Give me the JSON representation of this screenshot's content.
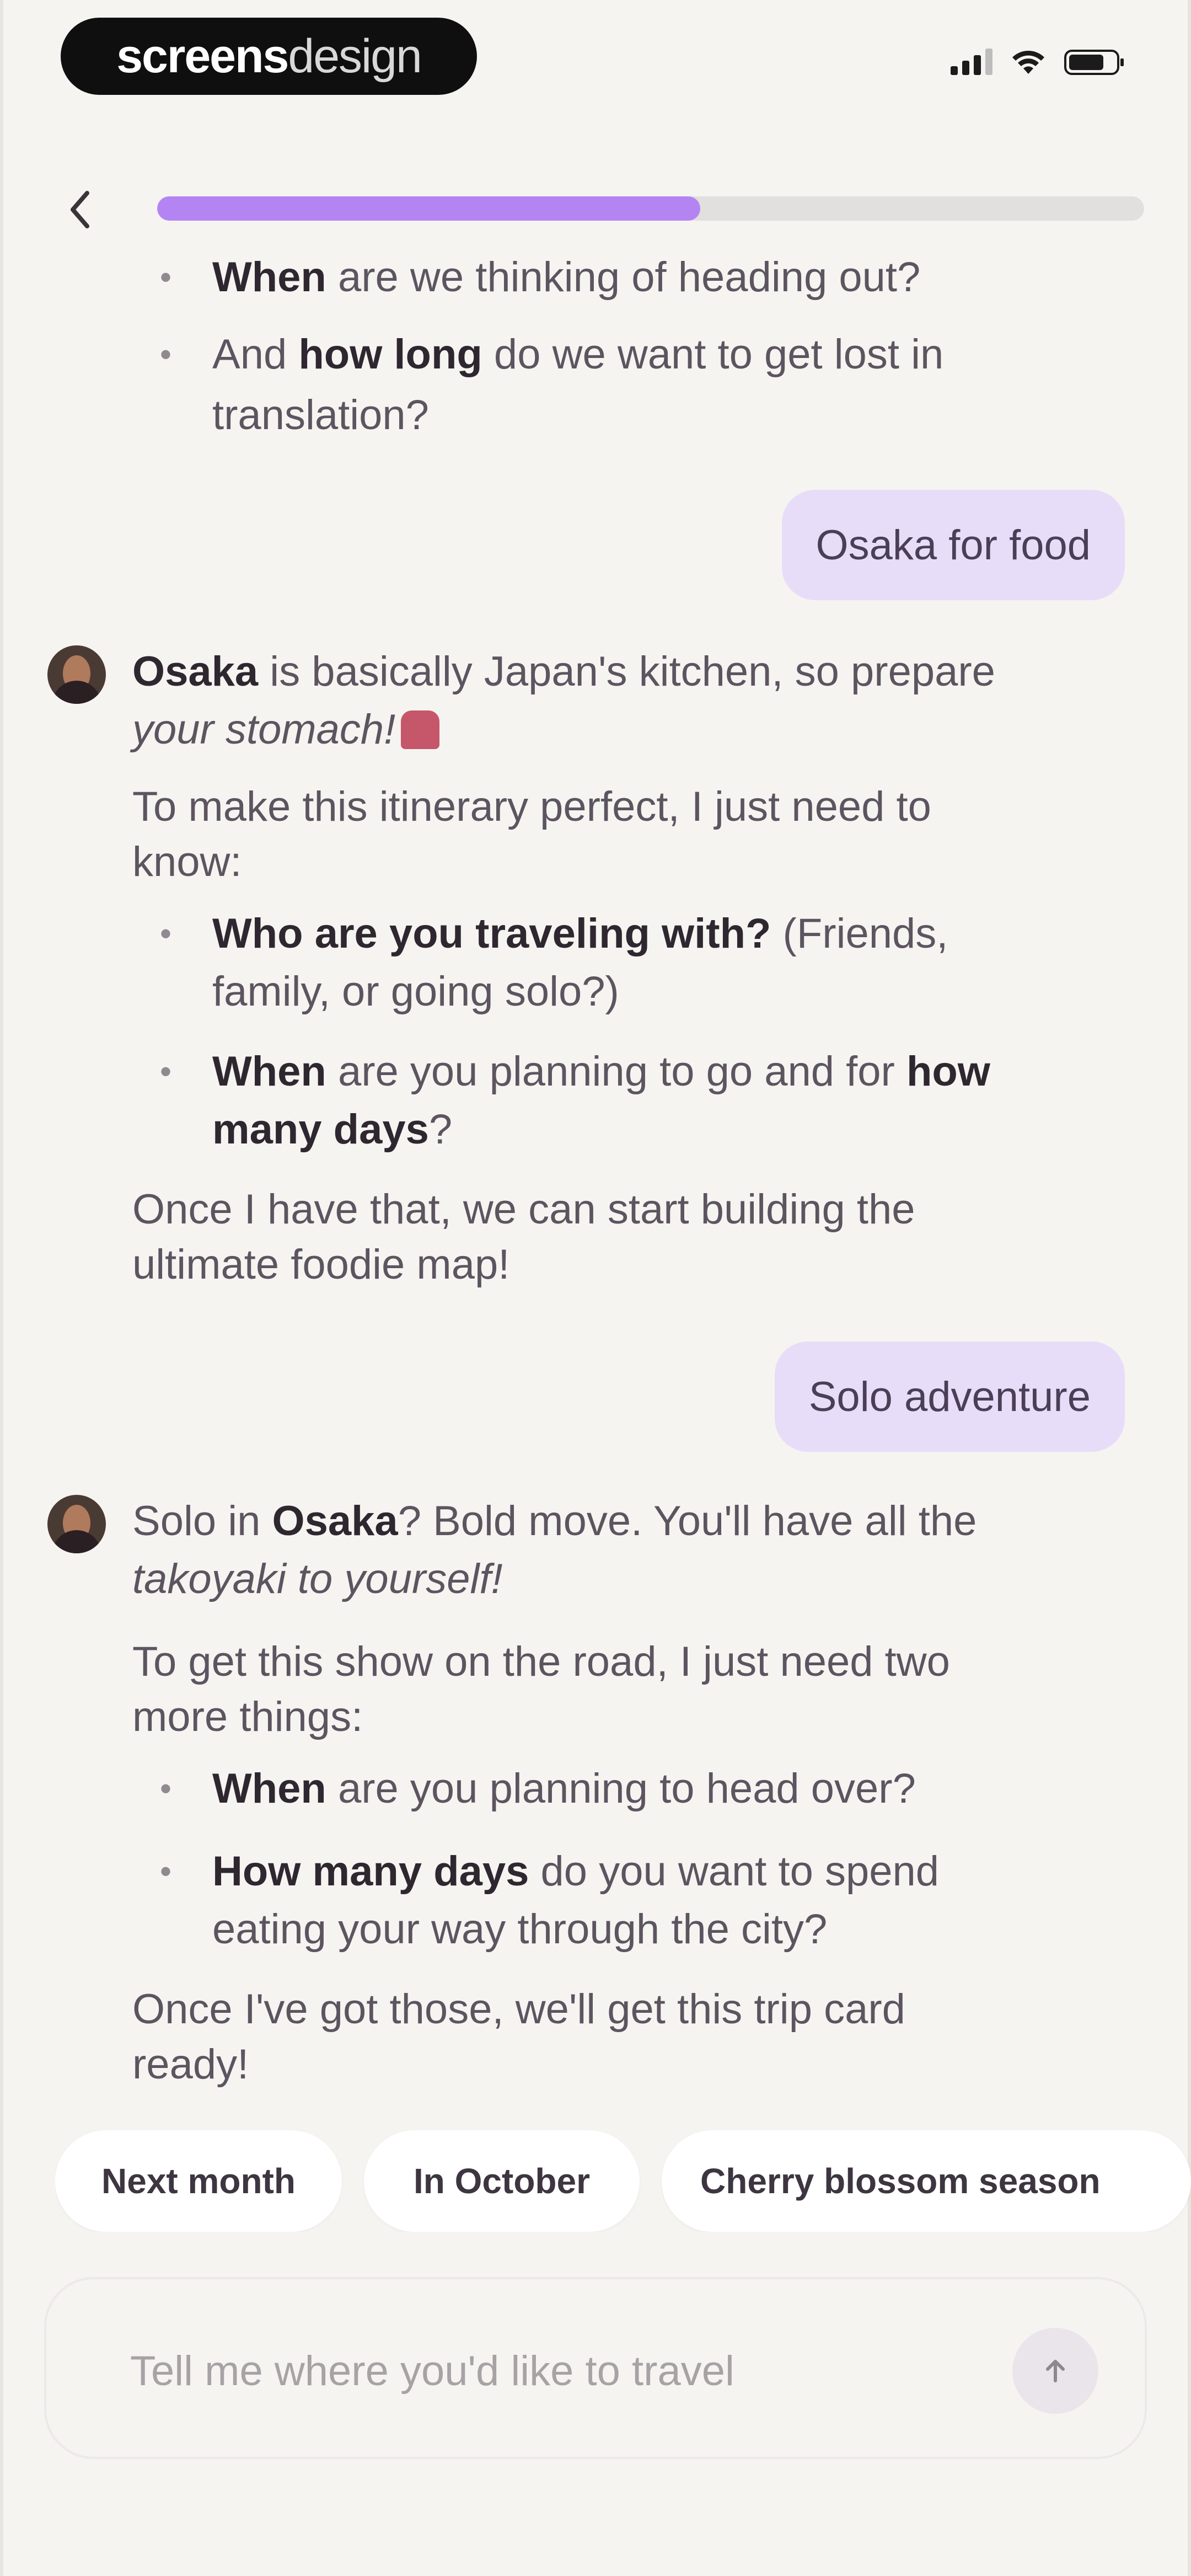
{
  "status_bar": {
    "brand_bold": "screens",
    "brand_light": "design",
    "signal_icon": "cellular-signal-icon",
    "wifi_icon": "wifi-icon",
    "battery_icon": "battery-icon"
  },
  "header": {
    "back_icon": "chevron-left-icon",
    "progress_fraction": 0.55,
    "accent_color": "#b584f3"
  },
  "chat": {
    "prev_bullet_1": {
      "bold": "When",
      "rest": " are we thinking of heading out?"
    },
    "prev_bullet_2": {
      "pre": "And ",
      "bold": "how long",
      "rest_line1": " do we want to get lost in",
      "line2": "translation?"
    },
    "user_msg_1": "Osaka for food",
    "bot_msg_1": {
      "line1_bold": "Osaka",
      "line1_rest": " is basically Japan's kitchen, so prepare",
      "line2": "your stomach!",
      "emoji_icon": "bento-box-icon",
      "para2_line1": "To make this itinerary perfect, I just need to",
      "para2_line2": "know:",
      "b1_bold": "Who are you traveling with?",
      "b1_rest": " (Friends,",
      "b1_line2": "family, or going solo?)",
      "b2_bold1": "When",
      "b2_mid": " are you planning to go and for ",
      "b2_bold2": "how",
      "b2_line2_bold": "many days",
      "b2_line2_rest": "?",
      "para3_line1": "Once I have that, we can start building the",
      "para3_line2": "ultimate foodie map!"
    },
    "user_msg_2": "Solo adventure",
    "bot_msg_2": {
      "l1_pre": "Solo in ",
      "l1_bold": "Osaka",
      "l1_rest": "? Bold move. You'll have all the",
      "l2_italic": "takoyaki",
      "l2_rest": " to yourself!",
      "para2_line1": "To get this show on the road, I just need two",
      "para2_line2": "more things:",
      "b1_bold": "When",
      "b1_rest": " are you planning to head over?",
      "b2_bold": "How many days",
      "b2_rest": " do you want to spend",
      "b2_line2": "eating your way through the city?",
      "para3_line1": "Once I've got those, we'll get this trip card",
      "para3_line2": "ready!"
    }
  },
  "suggestions": [
    "Next month",
    "In October",
    "Cherry blossom season"
  ],
  "input": {
    "placeholder": "Tell me where you'd like to travel",
    "send_icon": "arrow-up-icon"
  }
}
